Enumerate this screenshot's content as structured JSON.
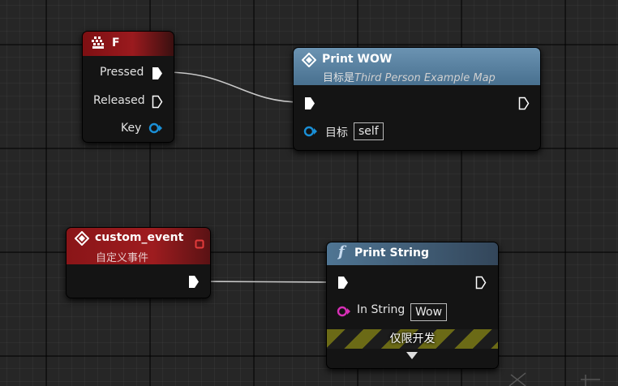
{
  "key_node": {
    "title": "F",
    "pins": {
      "pressed": "Pressed",
      "released": "Released",
      "key": "Key"
    }
  },
  "print_wow_node": {
    "title": "Print WOW",
    "subtitle_prefix": "目标是",
    "subtitle_target": "Third Person Example Map",
    "target_label": "目标",
    "target_value": "self"
  },
  "custom_event_node": {
    "title": "custom_event",
    "subtitle": "自定义事件"
  },
  "print_string_node": {
    "title": "Print String",
    "func_glyph": "f",
    "in_string_label": "In String",
    "in_string_value": "Wow",
    "development_only": "仅限开发"
  },
  "colors": {
    "event_header": "#9a1a1e",
    "func_header": "#4f7593",
    "exec_pin": "#ffffff",
    "object_pin": "#1a8fd6",
    "string_pin": "#d82fb7",
    "delegate_pin": "#e23b3b"
  }
}
